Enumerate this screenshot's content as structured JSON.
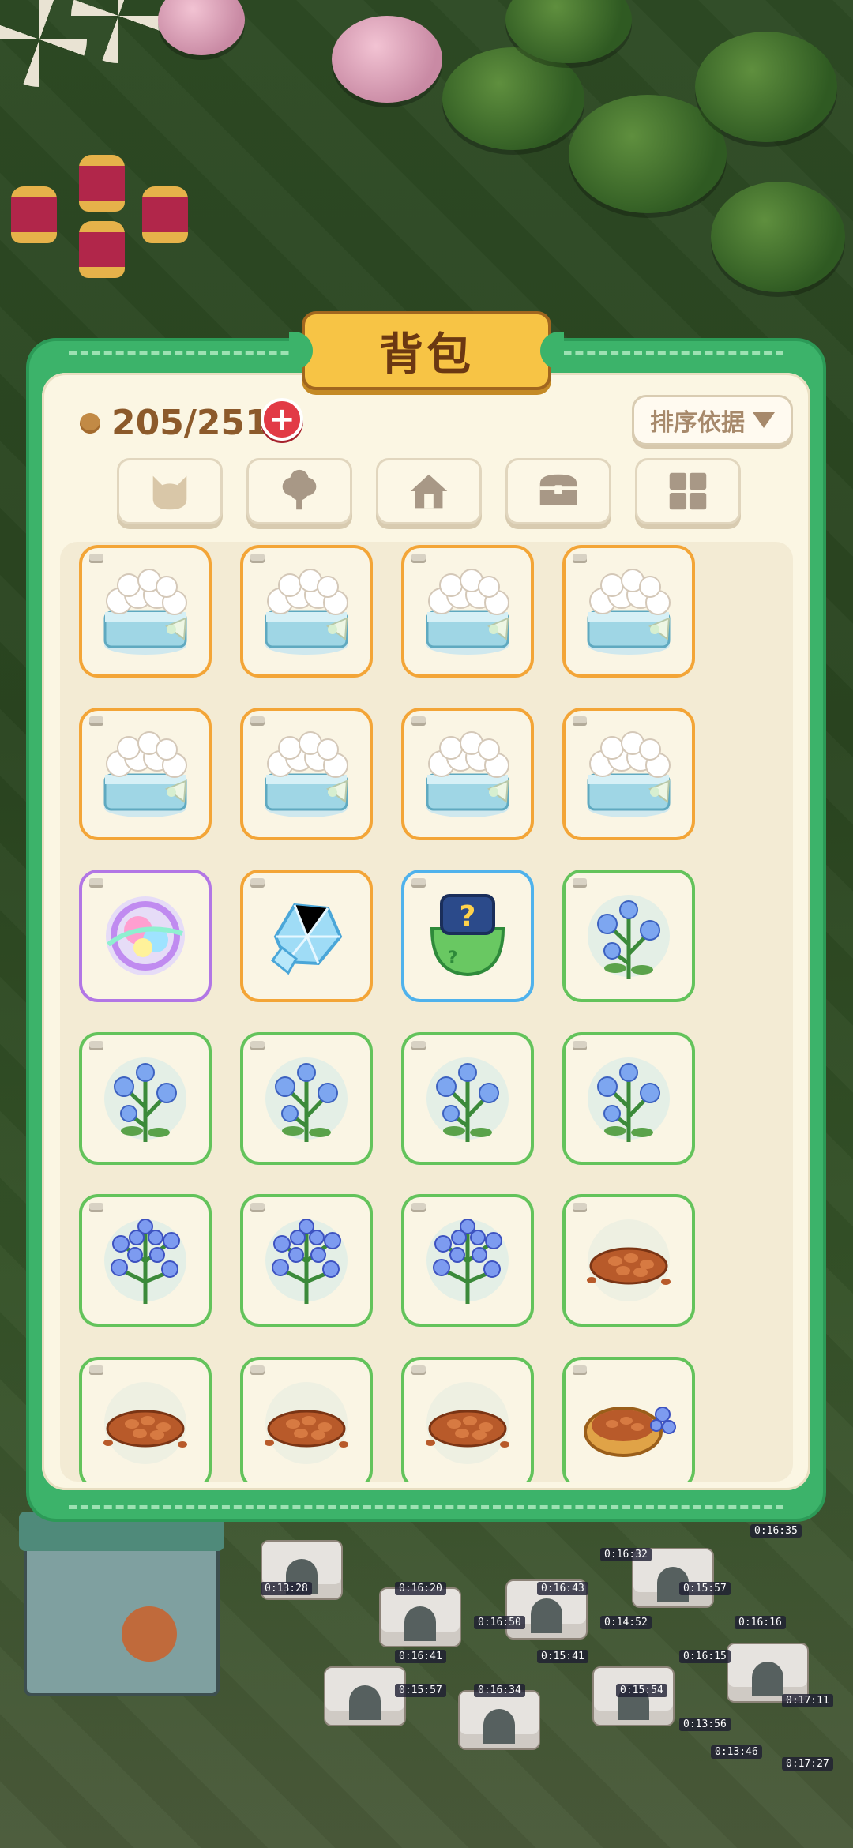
{
  "inventory": {
    "title": "背包",
    "capacity_text": "205/251",
    "add_button_glyph": "+",
    "sort_label": "排序依据",
    "tabs": [
      {
        "name": "cat-tab",
        "icon": "cat-icon"
      },
      {
        "name": "tree-tab",
        "icon": "tree-icon"
      },
      {
        "name": "house-tab",
        "icon": "house-icon"
      },
      {
        "name": "chest-tab",
        "icon": "chest-icon"
      },
      {
        "name": "grid-tab",
        "icon": "grid-icon"
      }
    ],
    "items": [
      {
        "name": "flower-basket-item",
        "rarity": "orange"
      },
      {
        "name": "flower-basket-item",
        "rarity": "orange"
      },
      {
        "name": "flower-basket-item",
        "rarity": "orange"
      },
      {
        "name": "flower-basket-item",
        "rarity": "orange"
      },
      {
        "name": "flower-basket-item",
        "rarity": "orange"
      },
      {
        "name": "flower-basket-item",
        "rarity": "orange"
      },
      {
        "name": "flower-basket-item",
        "rarity": "orange"
      },
      {
        "name": "flower-basket-item",
        "rarity": "orange"
      },
      {
        "name": "swirl-orb-item",
        "rarity": "purple"
      },
      {
        "name": "ice-crystal-item",
        "rarity": "orange"
      },
      {
        "name": "mystery-bag-item",
        "rarity": "blue"
      },
      {
        "name": "blue-flower-item",
        "rarity": "green"
      },
      {
        "name": "blue-flower-item",
        "rarity": "green"
      },
      {
        "name": "blue-flower-item",
        "rarity": "green"
      },
      {
        "name": "blue-flower-item",
        "rarity": "green"
      },
      {
        "name": "blue-flower-item",
        "rarity": "green"
      },
      {
        "name": "blue-flower-bunch-item",
        "rarity": "green"
      },
      {
        "name": "blue-flower-bunch-item",
        "rarity": "green"
      },
      {
        "name": "blue-flower-bunch-item",
        "rarity": "green"
      },
      {
        "name": "seed-pile-item",
        "rarity": "green"
      },
      {
        "name": "seed-pile-item",
        "rarity": "green"
      },
      {
        "name": "seed-pile-item",
        "rarity": "green"
      },
      {
        "name": "seed-pile-item",
        "rarity": "green"
      },
      {
        "name": "seed-bowl-item",
        "rarity": "green"
      }
    ],
    "colors": {
      "panel_green": "#3cb36a",
      "title_gold": "#f7c445",
      "rarity_orange": "#f3a537",
      "rarity_purple": "#b276e5",
      "rarity_blue": "#4fb2ec",
      "rarity_green": "#63c35b"
    }
  },
  "world_timers": [
    "0:16:35",
    "0:16:32",
    "0:15:57",
    "0:16:20",
    "0:16:43",
    "0:16:50",
    "0:14:52",
    "0:16:16",
    "0:16:41",
    "0:15:41",
    "0:16:15",
    "0:16:34",
    "0:15:54",
    "0:13:56",
    "0:17:11",
    "0:17:27",
    "0:13:28",
    "0:15:57",
    "0:13:46"
  ]
}
